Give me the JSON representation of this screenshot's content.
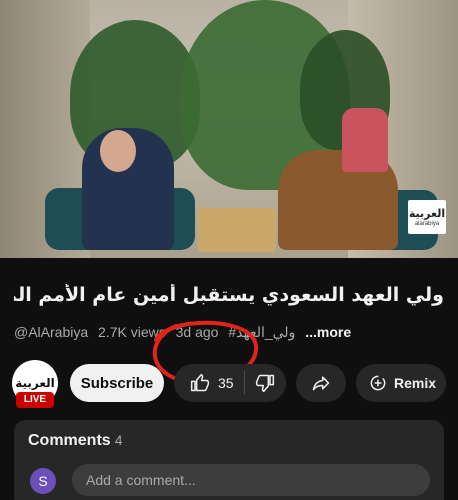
{
  "video": {
    "watermark_ar": "العربية",
    "watermark_en": "alarabiya"
  },
  "title": "ولي العهد السعودي يستقبل أمين عام الأمم المتحدة ...",
  "meta": {
    "channel": "@AlArabiya",
    "views": "2.7K views",
    "age": "3d ago",
    "hashtag": "#ولي_العهد",
    "more": "...more"
  },
  "channel": {
    "avatar_text": "العربية",
    "live_badge": "LIVE"
  },
  "actions": {
    "subscribe": "Subscribe",
    "like_count": "35",
    "remix": "Remix"
  },
  "comments": {
    "header": "Comments",
    "count": "4",
    "avatar_letter": "S",
    "placeholder": "Add a comment..."
  },
  "colors": {
    "background": "#0f0f0f",
    "card": "#272727",
    "live_red": "#cc0000",
    "annotation_red": "#e2231a"
  }
}
